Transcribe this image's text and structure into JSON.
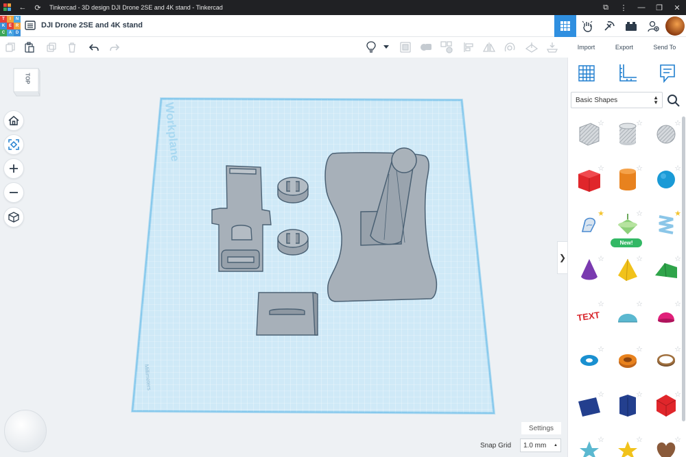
{
  "window": {
    "title": "Tinkercad - 3D design DJI Drone 2SE and 4K stand - Tinkercad"
  },
  "header": {
    "logo_letters": [
      "T",
      "I",
      "N",
      "K",
      "E",
      "R",
      "C",
      "A",
      "D"
    ],
    "logo_colors": [
      "#e6413a",
      "#f0a13a",
      "#4aa6e2",
      "#3a8fd9",
      "#e6413a",
      "#f0a13a",
      "#3aa657",
      "#4aa6e2",
      "#3a8fd9"
    ],
    "design_title": "DJI Drone 2SE and 4K stand",
    "views": [
      "grid-view-icon",
      "pointer-hand-icon",
      "pickaxe-icon",
      "bricks-icon",
      "add-user-icon"
    ],
    "active_view": "grid-view-icon"
  },
  "toolbar": {
    "actions": [
      "copy-icon",
      "paste-icon",
      "duplicate-icon",
      "delete-icon",
      "undo-icon",
      "redo-icon"
    ],
    "tools": [
      "lightbulb-icon",
      "show-hide-icon",
      "group-icon",
      "ungroup-icon",
      "align-icon",
      "mirror-icon",
      "cruise-icon",
      "workplane-tool-icon",
      "drop-icon"
    ],
    "import_label": "Import",
    "export_label": "Export",
    "send_to_label": "Send To"
  },
  "canvas": {
    "viewcube_label": "TOP",
    "workplane_label": "Workplane",
    "units_label": "Millimeters",
    "settings_label": "Settings",
    "snap_grid_label": "Snap Grid",
    "snap_grid_value": "1.0 mm",
    "nav_buttons": [
      "home-icon",
      "fit-view-icon",
      "zoom-in-icon",
      "zoom-out-icon",
      "orthographic-icon"
    ]
  },
  "panel": {
    "tools": [
      "workplane-icon",
      "ruler-icon",
      "notes-icon"
    ],
    "library_selected": "Basic Shapes",
    "new_badge": "New!",
    "shapes": [
      {
        "name": "box-hole",
        "color": "#b9bec4",
        "favorite": false
      },
      {
        "name": "cylinder-hole",
        "color": "#b9bec4",
        "favorite": false
      },
      {
        "name": "sphere-hole",
        "color": "#b9bec4",
        "favorite": false
      },
      {
        "name": "box",
        "color": "#e0262b",
        "favorite": false
      },
      {
        "name": "cylinder",
        "color": "#e8821e",
        "favorite": false
      },
      {
        "name": "sphere",
        "color": "#1a9ad6",
        "favorite": false
      },
      {
        "name": "scribble",
        "color": "#4a8ad0",
        "favorite": true
      },
      {
        "name": "spinning-top",
        "color": "#8ed07a",
        "favorite": false
      },
      {
        "name": "spring",
        "color": "#8bc6e8",
        "favorite": true
      },
      {
        "name": "cone",
        "color": "#7a3ab0",
        "favorite": false
      },
      {
        "name": "pyramid",
        "color": "#f1c21b",
        "favorite": false
      },
      {
        "name": "roof",
        "color": "#2fa44a",
        "favorite": false
      },
      {
        "name": "text",
        "color": "#d8262c",
        "favorite": false
      },
      {
        "name": "half-cylinder",
        "color": "#5bb8d0",
        "favorite": false
      },
      {
        "name": "half-sphere",
        "color": "#e0207a",
        "favorite": false
      },
      {
        "name": "torus",
        "color": "#1a90d0",
        "favorite": false
      },
      {
        "name": "tube",
        "color": "#e8821e",
        "favorite": false
      },
      {
        "name": "ring",
        "color": "#a0703e",
        "favorite": false
      },
      {
        "name": "wedge-box",
        "color": "#233f8e",
        "favorite": false
      },
      {
        "name": "polygon",
        "color": "#233f8e",
        "favorite": false
      },
      {
        "name": "icosahedron",
        "color": "#e0262b",
        "favorite": false
      },
      {
        "name": "star",
        "color": "#5bb8d0",
        "favorite": false
      },
      {
        "name": "star-yellow",
        "color": "#f1c21b",
        "favorite": false
      },
      {
        "name": "heart",
        "color": "#8a5a3a",
        "favorite": false
      }
    ]
  },
  "colors": {
    "accent": "#2f8fe0",
    "workplane": "#cfe9f7",
    "workplane_edge": "#79c2e8",
    "model": "#a7b0b9",
    "model_outline": "#4a6073"
  }
}
